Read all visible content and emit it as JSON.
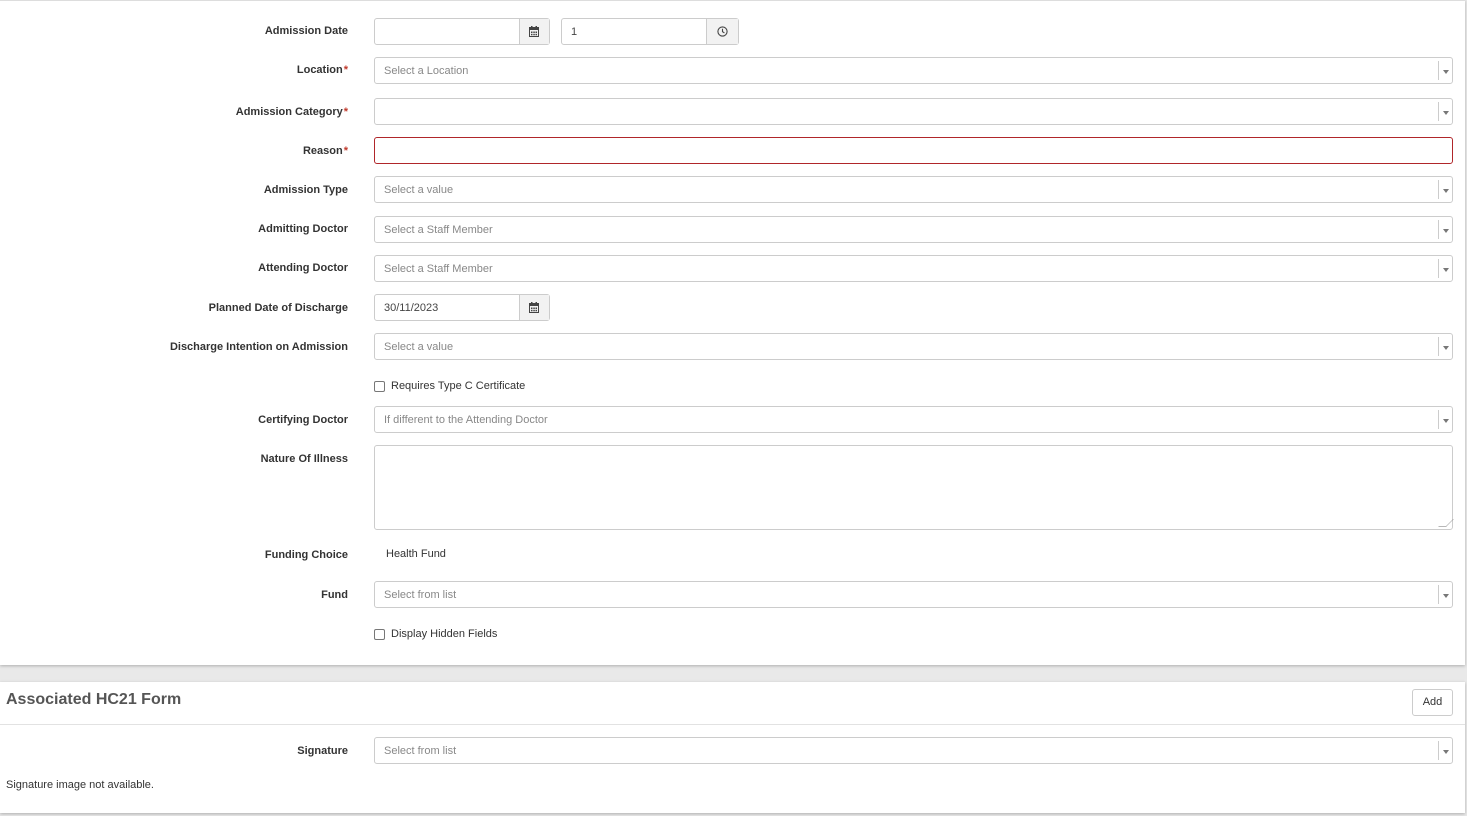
{
  "form": {
    "admission_date": {
      "label": "Admission Date",
      "date_value": "",
      "time_value": "1"
    },
    "location": {
      "label": "Location",
      "required_mark": "*",
      "placeholder": "Select a Location"
    },
    "admission_category": {
      "label": "Admission Category",
      "required_mark": "*",
      "placeholder": ""
    },
    "reason": {
      "label": "Reason",
      "required_mark": "*",
      "value": ""
    },
    "admission_type": {
      "label": "Admission Type",
      "placeholder": "Select a value"
    },
    "admitting_doctor": {
      "label": "Admitting Doctor",
      "placeholder": "Select a Staff Member"
    },
    "attending_doctor": {
      "label": "Attending Doctor",
      "placeholder": "Select a Staff Member"
    },
    "planned_discharge": {
      "label": "Planned Date of Discharge",
      "value": "30/11/2023"
    },
    "discharge_intention": {
      "label": "Discharge Intention on Admission",
      "placeholder": "Select a value"
    },
    "requires_type_c": {
      "label": "Requires Type C Certificate",
      "checked": false
    },
    "certifying_doctor": {
      "label": "Certifying Doctor",
      "placeholder": "If different to the Attending Doctor"
    },
    "nature_of_illness": {
      "label": "Nature Of Illness",
      "value": ""
    },
    "funding_choice": {
      "label": "Funding Choice",
      "value": "Health Fund"
    },
    "fund": {
      "label": "Fund",
      "placeholder": "Select from list"
    },
    "display_hidden": {
      "label": "Display Hidden Fields",
      "checked": false
    }
  },
  "hc21": {
    "title": "Associated HC21 Form",
    "add_label": "Add",
    "signature": {
      "label": "Signature",
      "placeholder": "Select from list"
    },
    "signature_note": "Signature image not available."
  },
  "icons": {
    "date_picker": "calendar-icon",
    "time_picker": "clock-icon",
    "dropdown": "caret-down-icon"
  },
  "colors": {
    "required": "#c0392b",
    "invalid_border": "#b0262a"
  }
}
